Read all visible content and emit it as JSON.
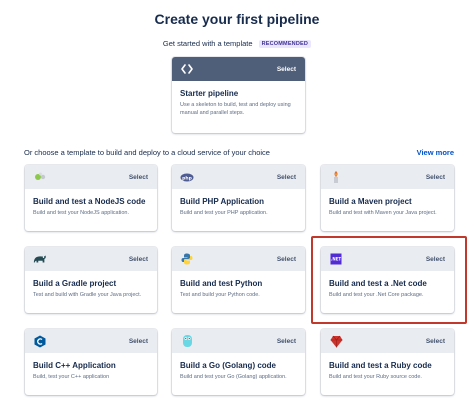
{
  "page": {
    "title": "Create your first pipeline",
    "subtitle": "Get started with a template",
    "badge": "RECOMMENDED"
  },
  "starter": {
    "icon": "code-brackets-icon",
    "select_label": "Select",
    "title": "Starter pipeline",
    "description": "Use a skeleton to build, test and deploy using manual and parallel steps."
  },
  "section": {
    "heading": "Or choose a template to build and deploy to a cloud service of your choice",
    "view_more": "View more"
  },
  "templates": [
    {
      "icon": "nodejs-icon",
      "select_label": "Select",
      "title": "Build and test a NodeJS code",
      "description": "Build and test your NodeJS application."
    },
    {
      "icon": "php-icon",
      "select_label": "Select",
      "title": "Build PHP Application",
      "description": "Build and test your PHP application."
    },
    {
      "icon": "maven-icon",
      "select_label": "Select",
      "title": "Build a Maven project",
      "description": "Build and test with Maven your Java project."
    },
    {
      "icon": "gradle-icon",
      "select_label": "Select",
      "title": "Build a Gradle project",
      "description": "Test and build with Gradle your Java project."
    },
    {
      "icon": "python-icon",
      "select_label": "Select",
      "title": "Build and test Python",
      "description": "Test and build your Python code."
    },
    {
      "icon": "dotnet-icon",
      "select_label": "Select",
      "title": "Build and test a .Net code",
      "description": "Build and test your .Net Core package."
    },
    {
      "icon": "cpp-icon",
      "select_label": "Select",
      "title": "Build C++ Application",
      "description": "Build, test your C++ application"
    },
    {
      "icon": "golang-icon",
      "select_label": "Select",
      "title": "Build a Go (Golang) code",
      "description": "Build and test your Go (Golang) application."
    },
    {
      "icon": "ruby-icon",
      "select_label": "Select",
      "title": "Build and test a Ruby code",
      "description": "Build and test your Ruby source code."
    }
  ],
  "colors": {
    "accent": "#0052cc",
    "card_header": "#e9ecf0",
    "starter_header": "#505f79",
    "highlight": "#c0392b"
  }
}
